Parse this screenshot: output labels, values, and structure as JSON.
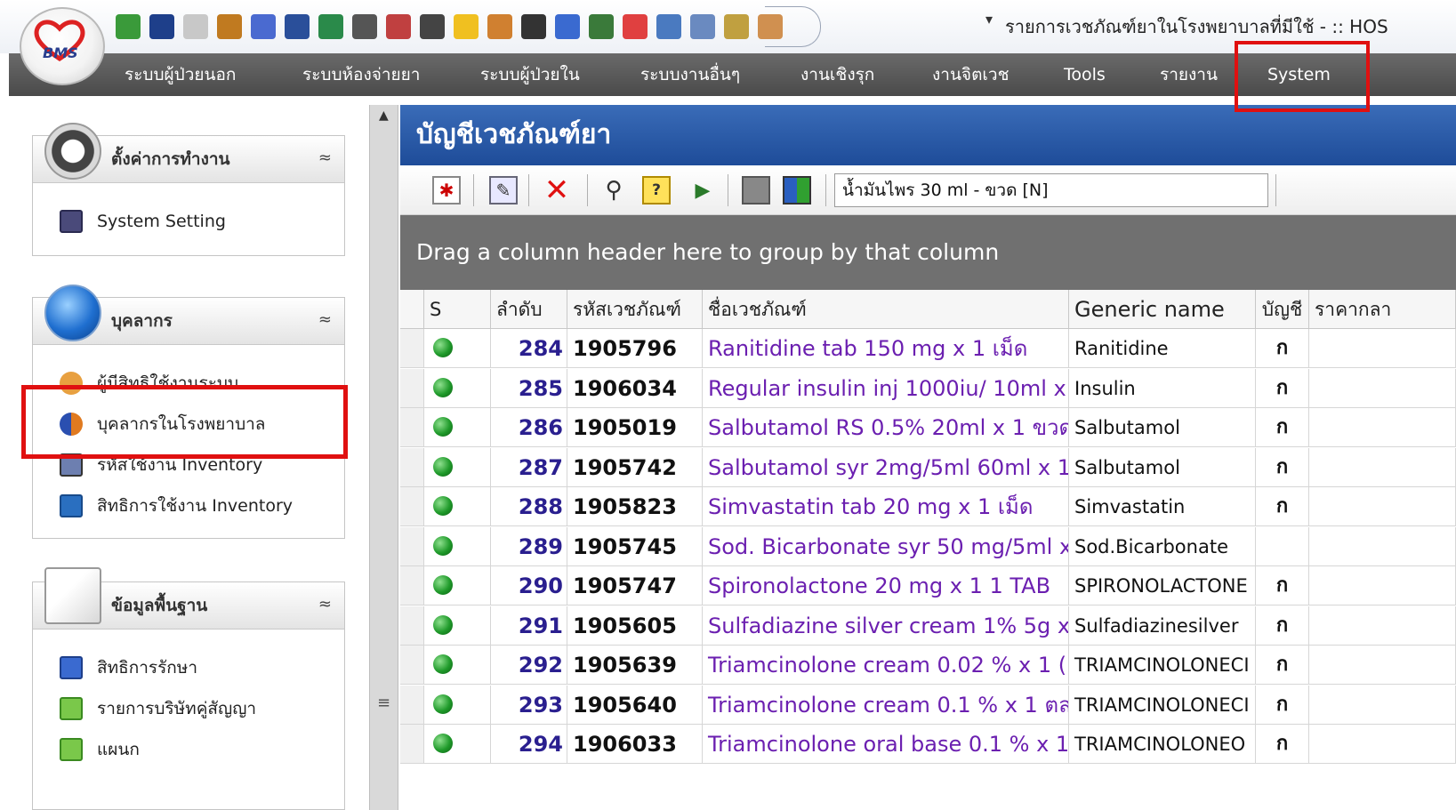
{
  "app": {
    "logo_text": "BMS",
    "window_title": "รายการเวชภัณฑ์ยาในโรงพยาบาลที่มีใช้ - :: HOS"
  },
  "quick_access": {
    "icons": [
      "add-user-icon",
      "media-icon",
      "document-icon",
      "person-edit-icon",
      "edit-icon",
      "note-icon",
      "download-icon",
      "calculator-icon",
      "grid-icon",
      "form-icon",
      "lightning-icon",
      "user-icon",
      "list-icon",
      "monitor-icon",
      "clock-icon",
      "home-icon",
      "report-icon",
      "display-icon",
      "id-card-icon",
      "person-icon"
    ],
    "dropdown_glyph": "▾"
  },
  "menu": {
    "items": [
      "ระบบผู้ป่วยนอก",
      "ระบบห้องจ่ายยา",
      "ระบบผู้ป่วยใน",
      "ระบบงานอื่นๆ",
      "งานเชิงรุก",
      "งานจิตเวช",
      "Tools",
      "รายงาน",
      "System"
    ]
  },
  "sidebar": {
    "panels": [
      {
        "title": "ตั้งค่าการทำงาน",
        "items": [
          "System Setting"
        ]
      },
      {
        "title": "บุคลากร",
        "items": [
          "ผู้มีสิทธิใช้งานระบบ",
          "บุคลากรในโรงพยาบาล",
          "รหัสใช้งาน Inventory",
          "สิทธิการใช้งาน Inventory"
        ]
      },
      {
        "title": "ข้อมูลพื้นฐาน",
        "items": [
          "สิทธิการรักษา",
          "รายการบริษัทคู่สัญญา",
          "แผนก"
        ]
      }
    ],
    "collapse_glyph": "≈"
  },
  "main": {
    "title": "บัญชีเวชภัณฑ์ยา",
    "search_value": "น้ำมันไพร 30 ml - ขวด [N]",
    "group_hint": "Drag a column header here to group by that column",
    "columns": [
      "S",
      "ลำดับ",
      "รหัสเวชภัณฑ์",
      "ชื่อเวชภัณฑ์",
      "Generic name",
      "บัญชี",
      "ราคากลา"
    ],
    "rows": [
      {
        "no": "284",
        "code": "1905796",
        "name": "Ranitidine tab 150 mg x 1 เม็ด",
        "generic": "Ranitidine",
        "acc": "ก"
      },
      {
        "no": "285",
        "code": "1906034",
        "name": "Regular insulin inj 1000iu/ 10ml x",
        "generic": "Insulin",
        "acc": "ก"
      },
      {
        "no": "286",
        "code": "1905019",
        "name": "Salbutamol RS 0.5% 20ml x 1 ขวด",
        "generic": "Salbutamol",
        "acc": "ก"
      },
      {
        "no": "287",
        "code": "1905742",
        "name": "Salbutamol syr 2mg/5ml 60ml x 1",
        "generic": "Salbutamol",
        "acc": "ก"
      },
      {
        "no": "288",
        "code": "1905823",
        "name": "Simvastatin tab 20 mg x 1 เม็ด",
        "generic": "Simvastatin",
        "acc": "ก"
      },
      {
        "no": "289",
        "code": "1905745",
        "name": "Sod. Bicarbonate syr 50 mg/5ml x",
        "generic": "Sod.Bicarbonate",
        "acc": ""
      },
      {
        "no": "290",
        "code": "1905747",
        "name": "Spironolactone 20 mg x 1 1 TAB",
        "generic": "SPIRONOLACTONE",
        "acc": "ก"
      },
      {
        "no": "291",
        "code": "1905605",
        "name": "Sulfadiazine silver cream 1% 5g x",
        "generic": "Sulfadiazinesilver",
        "acc": "ก"
      },
      {
        "no": "292",
        "code": "1905639",
        "name": "Triamcinolone cream 0.02 % x 1 (",
        "generic": "TRIAMCINOLONECI",
        "acc": "ก"
      },
      {
        "no": "293",
        "code": "1905640",
        "name": "Triamcinolone cream 0.1 % x 1 ตล",
        "generic": "TRIAMCINOLONECI",
        "acc": "ก"
      },
      {
        "no": "294",
        "code": "1906033",
        "name": "Triamcinolone oral base 0.1 % x 1",
        "generic": "TRIAMCINOLONEO",
        "acc": "ก"
      }
    ]
  },
  "colors": {
    "menubar": "#555555",
    "pane_header": "#2b5aa6",
    "highlight": "#e01010",
    "drug_name": "#6b1fb0",
    "row_number": "#2a1f8f"
  }
}
